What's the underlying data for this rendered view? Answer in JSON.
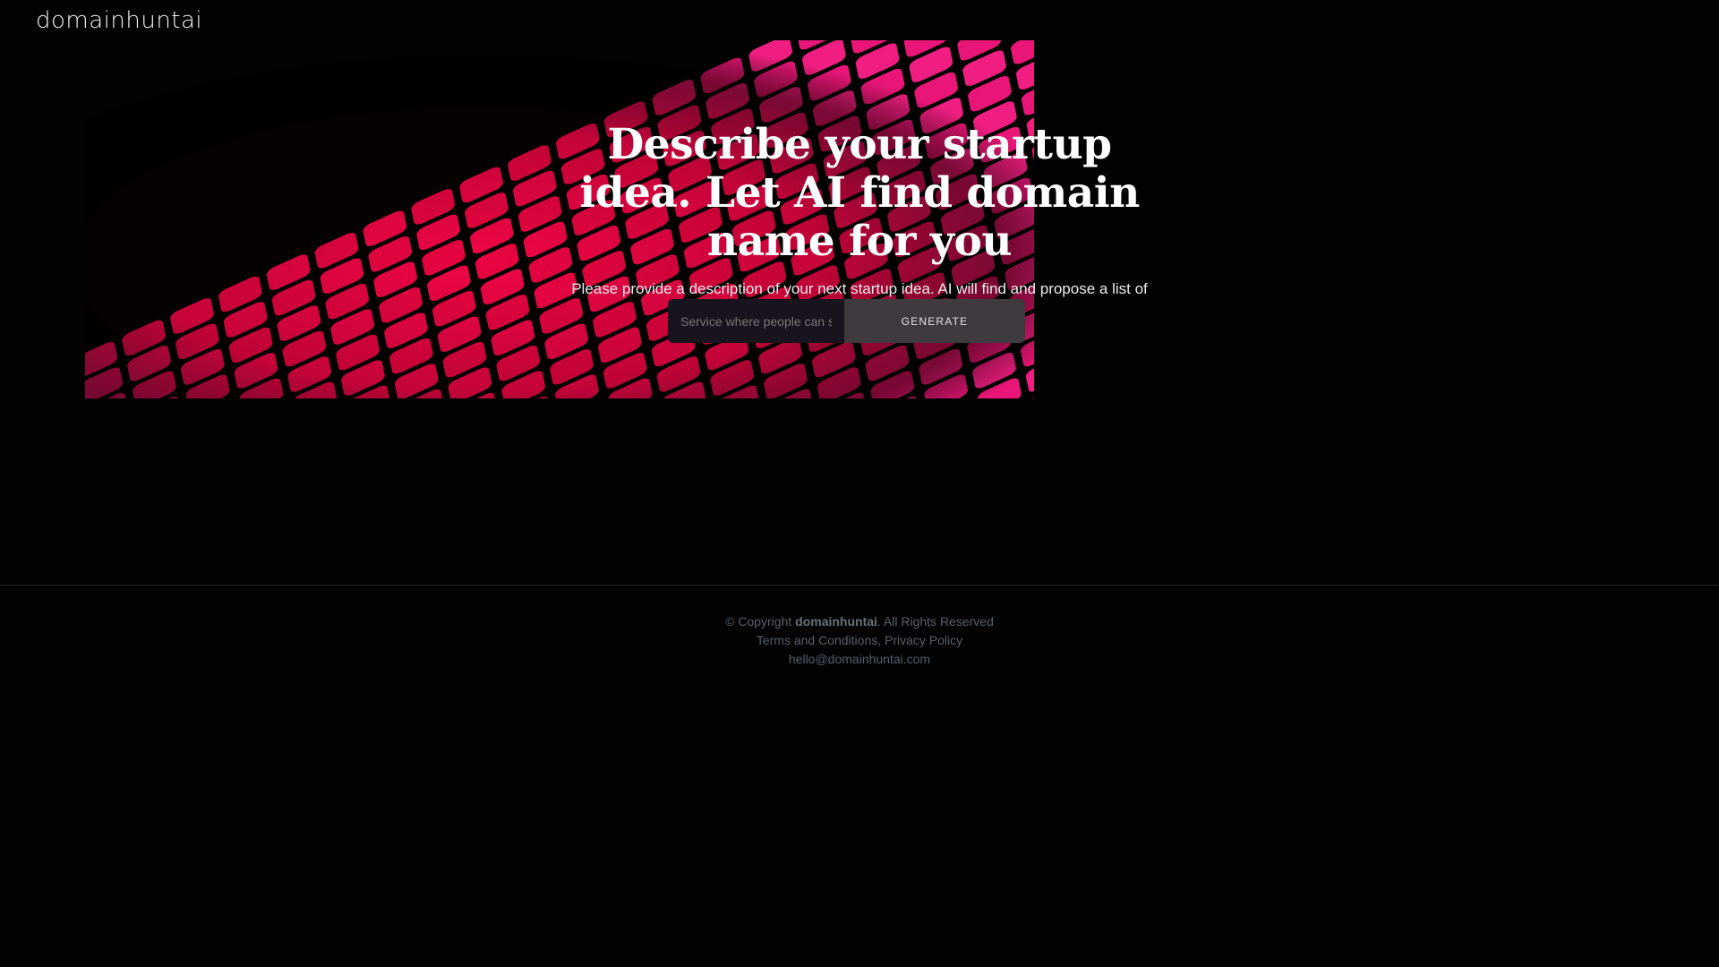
{
  "brand": {
    "name": "domainhuntai"
  },
  "hero": {
    "headline": "Describe your startup idea. Let AI find domain name for you",
    "subtitle": "Please provide a description of your next startup idea. AI will find and propose a list of interesting domain names for you.",
    "input_placeholder": "Service where people can share",
    "button_label": "GENERATE"
  },
  "footer": {
    "copyright_prefix": "© Copyright",
    "copyright_brand": "domainhuntai",
    "copyright_suffix": ". All Rights Reserved",
    "terms_label": "Terms and Conditions",
    "separator": ",",
    "privacy_label": "Privacy Policy",
    "email": "hello@domainhuntai.com"
  },
  "colors": {
    "background": "#030203",
    "accent_pink": "#ff1c7d",
    "button_bg": "#3f3a3e",
    "input_bg": "#17141d",
    "footer_text": "#55606a"
  },
  "icons": {
    "hero_art": "pink-grid-illustration"
  }
}
